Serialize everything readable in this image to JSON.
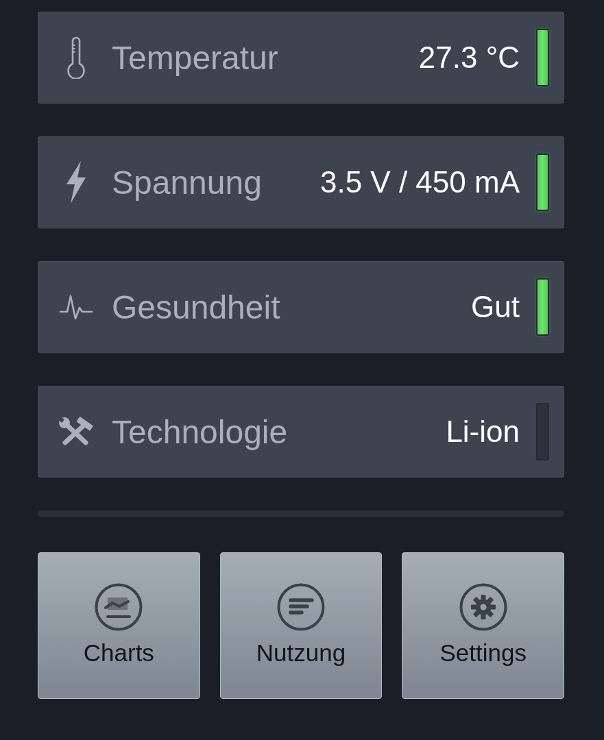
{
  "readings": [
    {
      "label": "Temperatur",
      "value": "27.3 °C",
      "on": true
    },
    {
      "label": "Spannung",
      "value": "3.5 V / 450 mA",
      "on": true
    },
    {
      "label": "Gesundheit",
      "value": "Gut",
      "on": true
    },
    {
      "label": "Technologie",
      "value": "Li-ion",
      "on": false
    }
  ],
  "actions": [
    {
      "label": "Charts"
    },
    {
      "label": "Nutzung"
    },
    {
      "label": "Settings"
    }
  ]
}
